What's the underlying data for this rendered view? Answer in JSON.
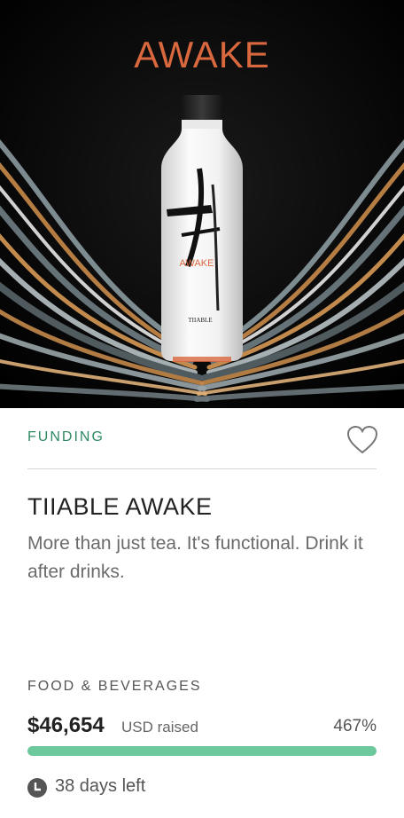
{
  "hero": {
    "brand_text": "AWAKE",
    "bottle_mark": "AWAKE",
    "bottle_brand": "TIIABLE"
  },
  "card": {
    "status": "FUNDING",
    "title": "TIIABLE AWAKE",
    "tagline": "More than just tea. It's functional. Drink it after drinks.",
    "category": "FOOD & BEVERAGES",
    "amount": "$46,654",
    "currency_label": "USD raised",
    "percent": "467%",
    "days_left": "38 days left"
  },
  "progress_fraction": 1.0,
  "icons": {
    "favorite": "heart-icon",
    "time": "clock-icon"
  },
  "colors": {
    "status": "#2f8a63",
    "progress": "#6cc99b",
    "brand": "#d9683f"
  }
}
